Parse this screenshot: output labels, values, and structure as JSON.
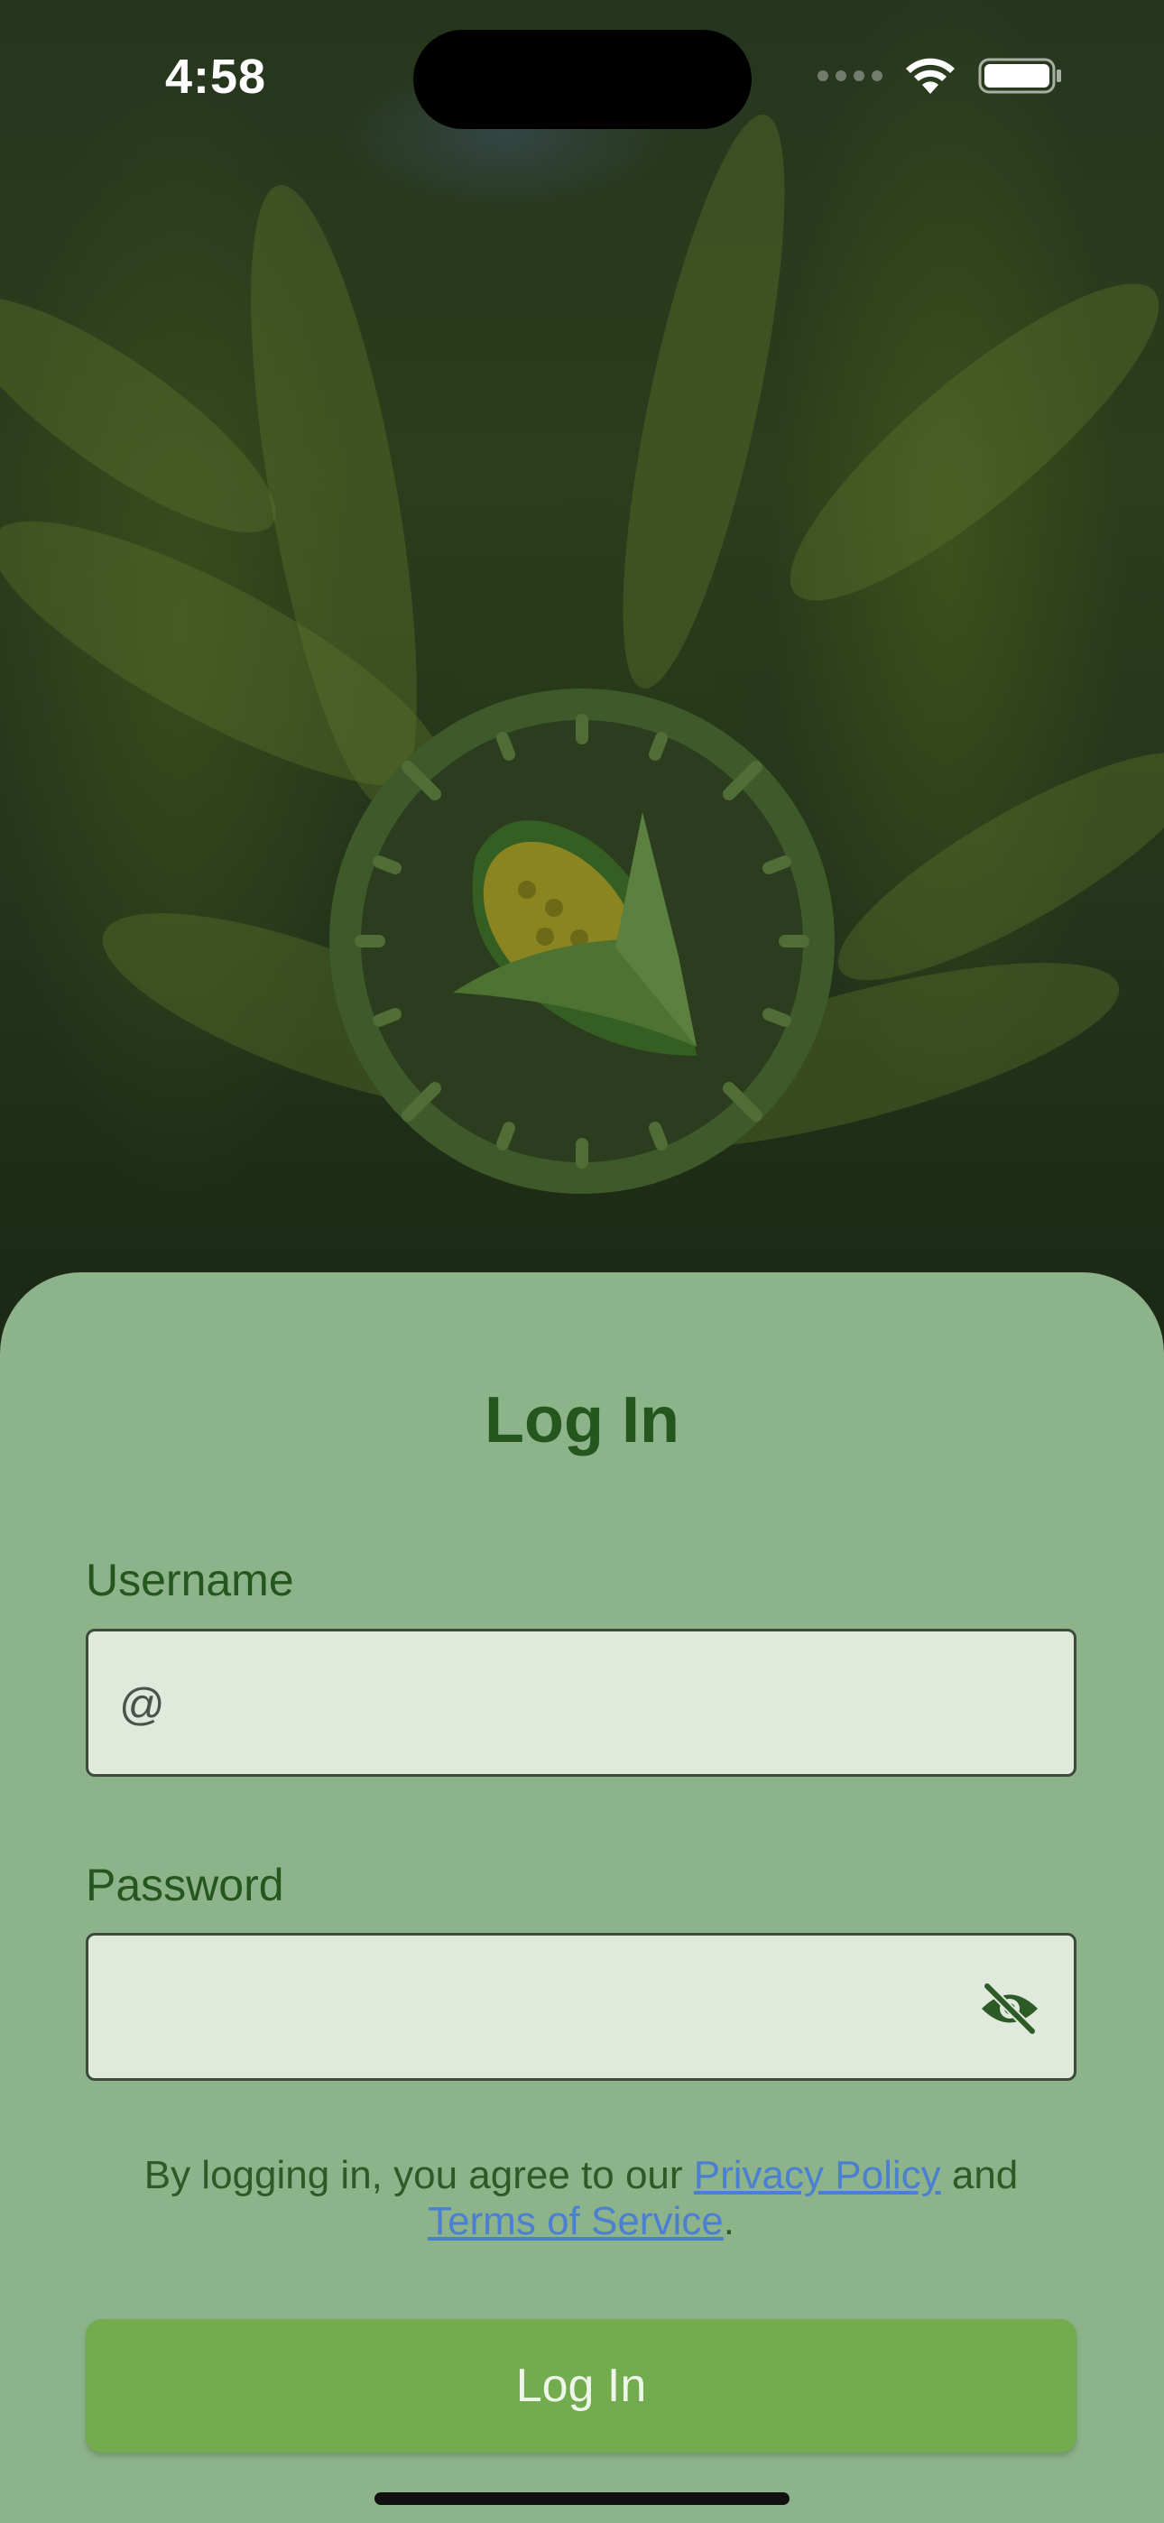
{
  "status_bar": {
    "time": "4:58"
  },
  "login": {
    "title": "Log In",
    "username_label": "Username",
    "username_prefix": "@",
    "username_value": "",
    "password_label": "Password",
    "password_value": "",
    "terms": {
      "prefix": "By logging in, you agree to our ",
      "privacy_link": "Privacy Policy",
      "middle": " and ",
      "tos_link": "Terms of Service",
      "suffix": "."
    },
    "button_label": "Log In"
  },
  "colors": {
    "sheet": "#8db38a",
    "primary_text": "#25561e",
    "field_bg": "#dfe9dc",
    "button": "#73ac4e",
    "link": "#4b7fd2"
  },
  "icons": [
    "wifi-icon",
    "battery-icon",
    "corn-clock-logo",
    "eye-off-icon"
  ]
}
